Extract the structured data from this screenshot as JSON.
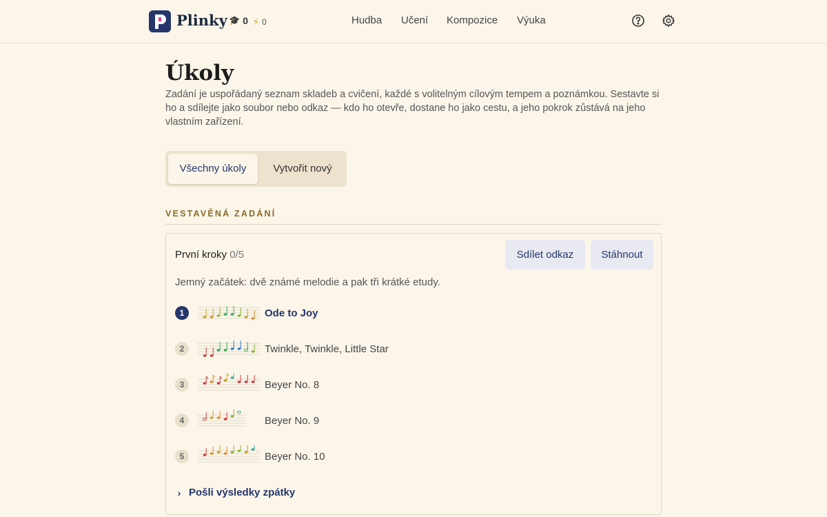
{
  "app": {
    "brand": "Plinky",
    "xp": "0",
    "streak": "0",
    "nav": [
      "Hudba",
      "Učení",
      "Kompozice",
      "Výuka"
    ]
  },
  "page": {
    "title": "Úkoly",
    "intro": "Zadání je uspořádaný seznam skladeb a cvičení, každé s volitelným cílovým tempem a poznámkou. Sestavte si ho a sdílejte jako soubor nebo odkaz — kdo ho otevře, dostane ho jako cestu, a jeho pokrok zůstává na jeho vlastním zařízení.",
    "tabs": [
      {
        "label": "Všechny úkoly",
        "active": true
      },
      {
        "label": "Vytvořit nový",
        "active": false
      }
    ],
    "section_label": "VESTAVĚNÁ ZADÁNÍ"
  },
  "assignment": {
    "title": "První kroky",
    "progress": "0/5",
    "share_label": "Sdílet odkaz",
    "download_label": "Stáhnout",
    "description": "Jemný začátek: dvě známé melodie a pak tři krátké etudy.",
    "items": [
      {
        "number": "1",
        "title": "Ode to Joy",
        "active": true
      },
      {
        "number": "2",
        "title": "Twinkle, Twinkle, Little Star",
        "active": false
      },
      {
        "number": "3",
        "title": "Beyer No. 8",
        "active": false
      },
      {
        "number": "4",
        "title": "Beyer No. 9",
        "active": false
      },
      {
        "number": "5",
        "title": "Beyer No. 10",
        "active": false
      }
    ],
    "footer_link": "Pošli výsledky zpátky"
  },
  "colors": {
    "background": "#fcf6ea",
    "accent": "#24366b",
    "section_label": "#8a6a2a",
    "button_bg": "#e8e9f1"
  },
  "icons": {
    "xp": "graduation-cap-icon",
    "streak": "lightning-icon",
    "help": "help-circle-icon",
    "settings": "gear-icon",
    "footer": "chevron-right-icon"
  }
}
